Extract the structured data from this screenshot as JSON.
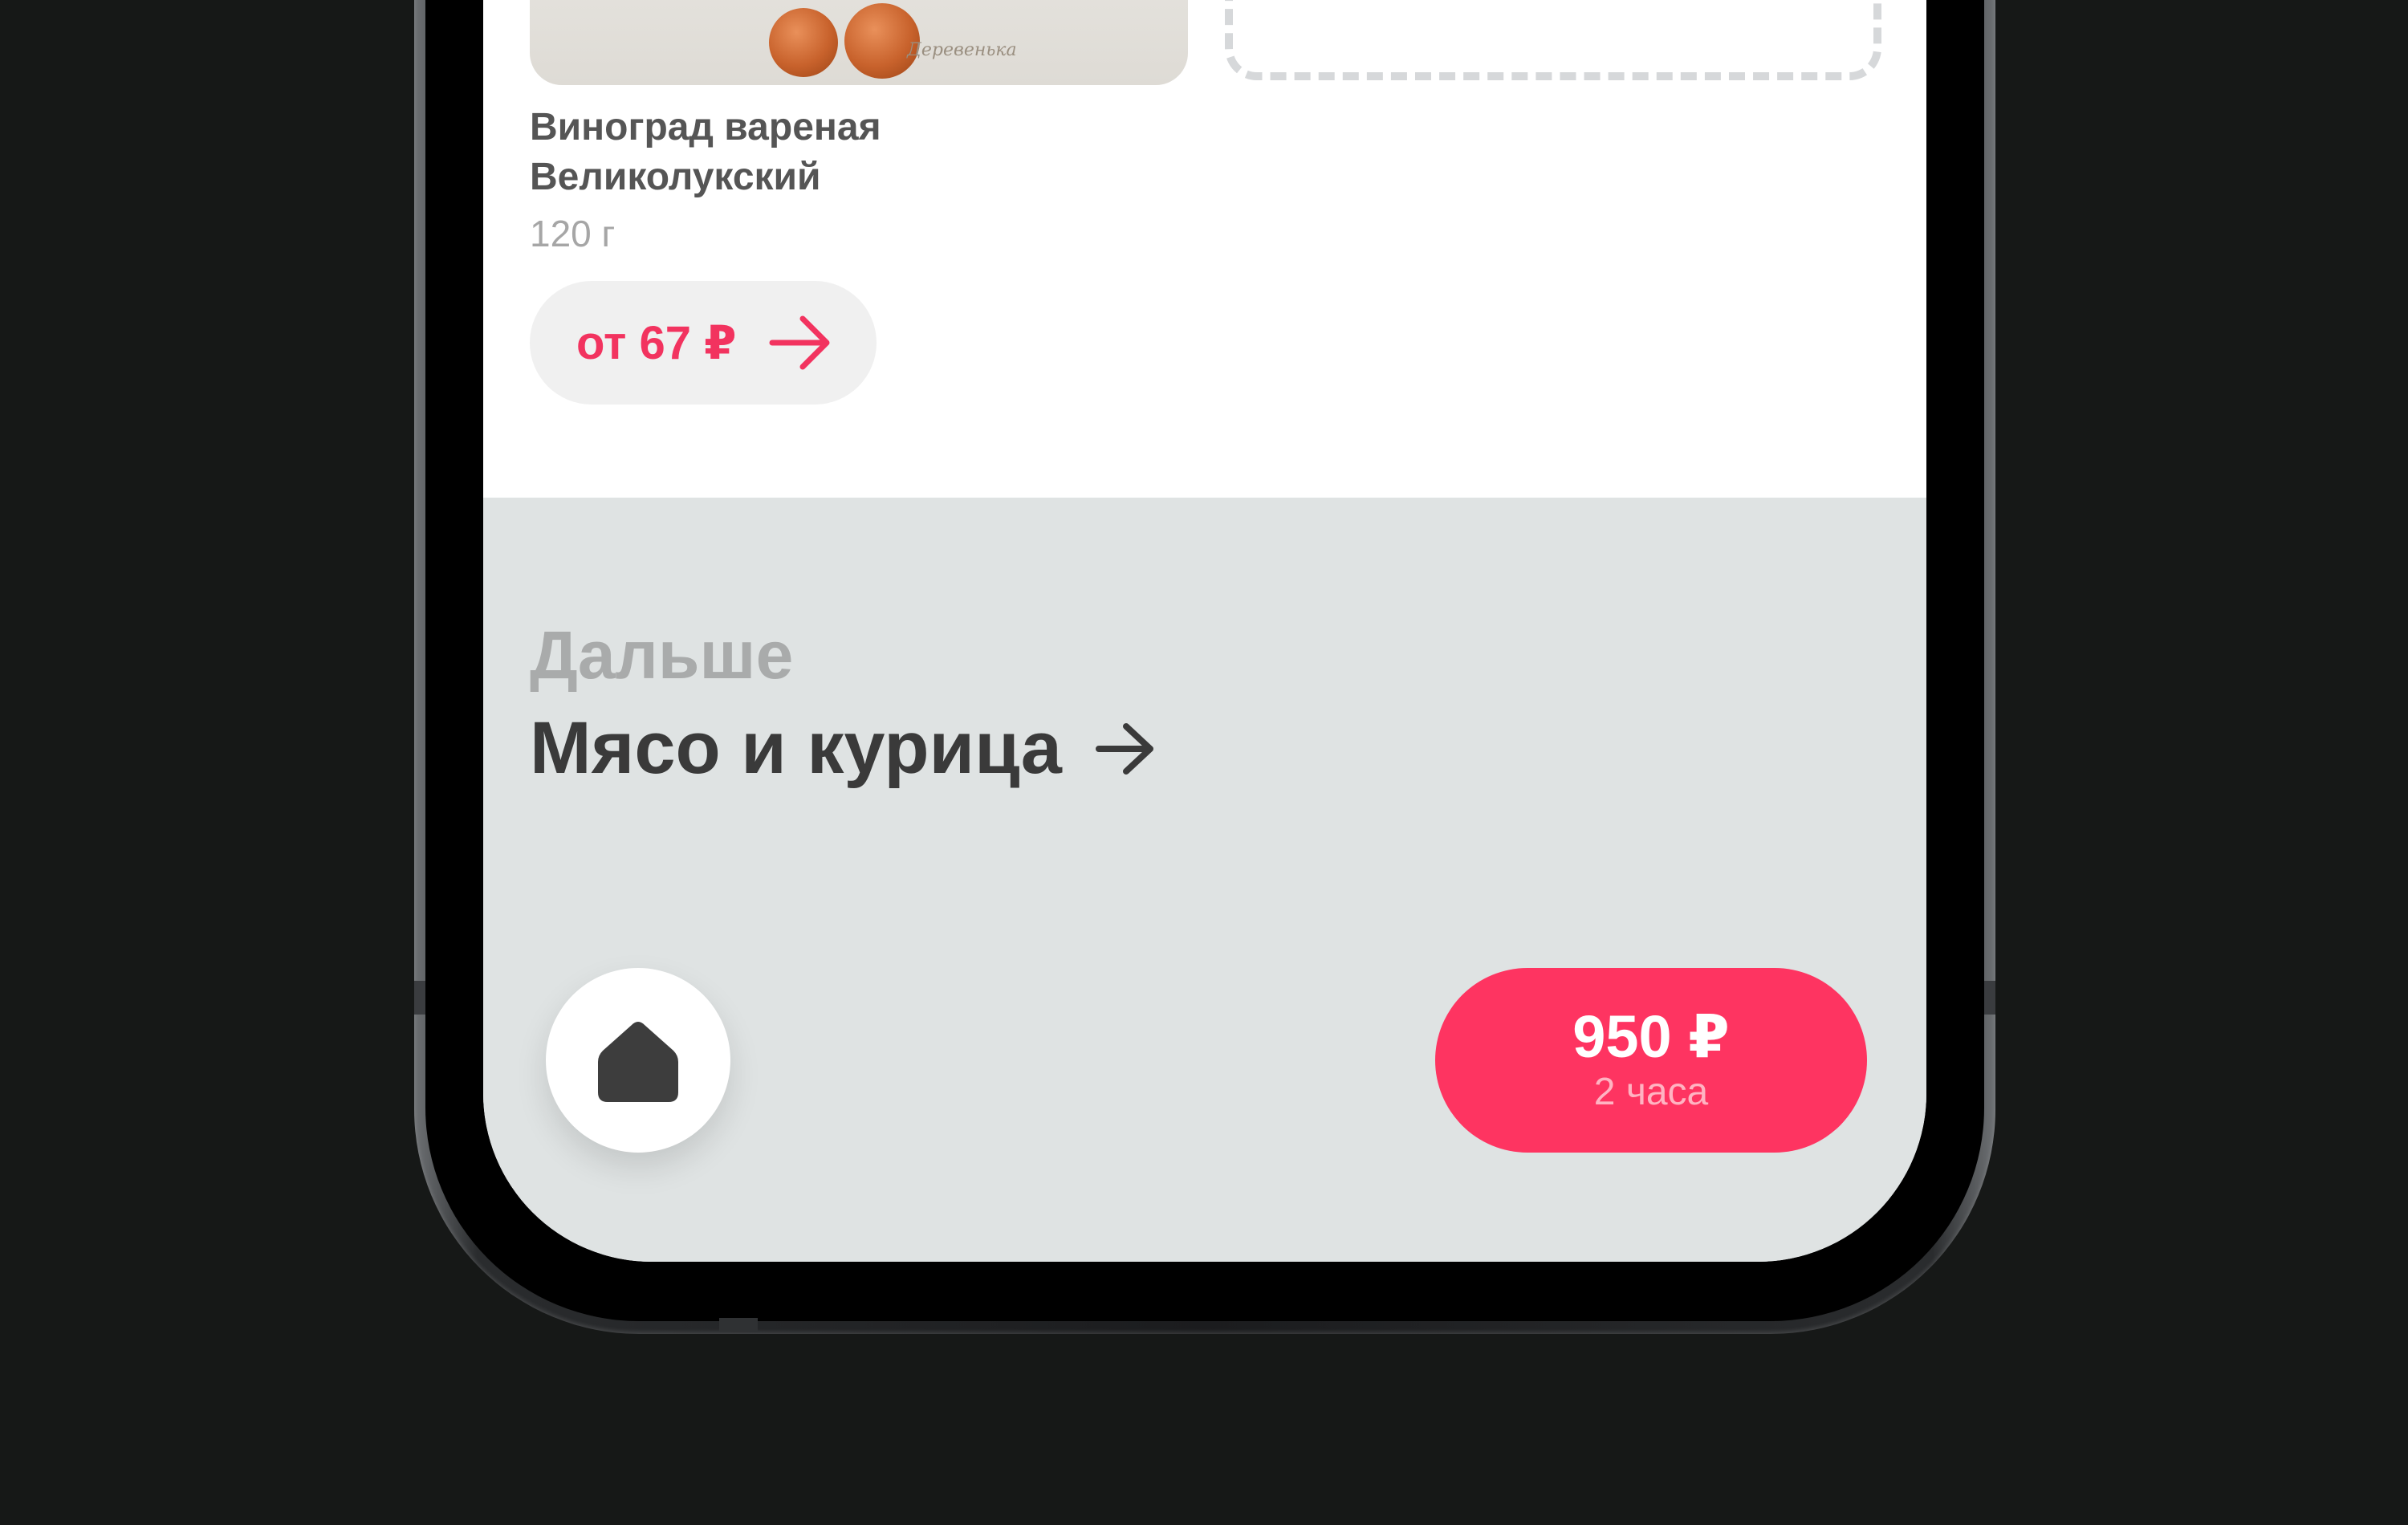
{
  "product": {
    "name": "Виноград вареная Великолукский",
    "weight": "120 г",
    "price_label": "от 67 ₽",
    "image_caption": "Деревенька"
  },
  "next_section": {
    "label": "Дальше",
    "title": "Мясо и курица"
  },
  "cart": {
    "total": "950 ₽",
    "eta": "2 часа"
  },
  "colors": {
    "accent": "#fe3461",
    "price_text": "#f2335f",
    "section_bg": "#dfe3e3",
    "page_bg": "#161817"
  },
  "icons": {
    "price_arrow": "arrow-right-icon",
    "title_arrow": "arrow-right-icon",
    "home": "home-icon"
  }
}
